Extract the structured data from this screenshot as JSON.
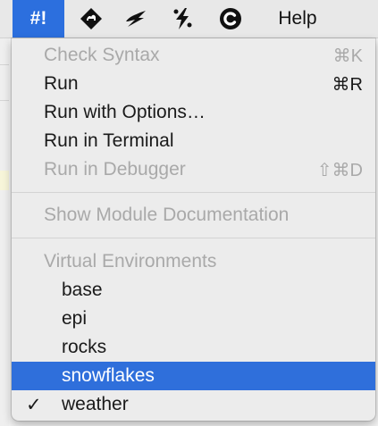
{
  "menubar": {
    "items": [
      {
        "label": "#!",
        "icon": null,
        "active": true
      },
      {
        "label": "",
        "icon": "perl-camel-diamond-icon"
      },
      {
        "label": "",
        "icon": "python-lightning-icon"
      },
      {
        "label": "",
        "icon": "slack-lightning-icon"
      },
      {
        "label": "",
        "icon": "c-circle-icon"
      },
      {
        "label": "Help",
        "icon": null
      }
    ]
  },
  "menu": {
    "check_syntax": {
      "label": "Check Syntax",
      "shortcut": "⌘K",
      "enabled": false
    },
    "run": {
      "label": "Run",
      "shortcut": "⌘R",
      "enabled": true
    },
    "run_with_options": {
      "label": "Run with Options…",
      "shortcut": "",
      "enabled": true
    },
    "run_in_terminal": {
      "label": "Run in Terminal",
      "shortcut": "",
      "enabled": true
    },
    "run_in_debugger": {
      "label": "Run in Debugger",
      "shortcut": "⇧⌘D",
      "enabled": false
    },
    "show_module_docs": {
      "label": "Show Module Documentation",
      "enabled": false
    },
    "virtual_envs": {
      "header": "Virtual Environments",
      "items": [
        {
          "label": "base",
          "checked": false,
          "highlighted": false
        },
        {
          "label": "epi",
          "checked": false,
          "highlighted": false
        },
        {
          "label": "rocks",
          "checked": false,
          "highlighted": false
        },
        {
          "label": "snowflakes",
          "checked": false,
          "highlighted": true
        },
        {
          "label": "weather",
          "checked": true,
          "highlighted": false
        }
      ],
      "check_mark": "✓"
    }
  },
  "colors": {
    "accent": "#2f6fdb",
    "disabled_text": "#a9a9a9",
    "menu_bg": "#ececec"
  }
}
